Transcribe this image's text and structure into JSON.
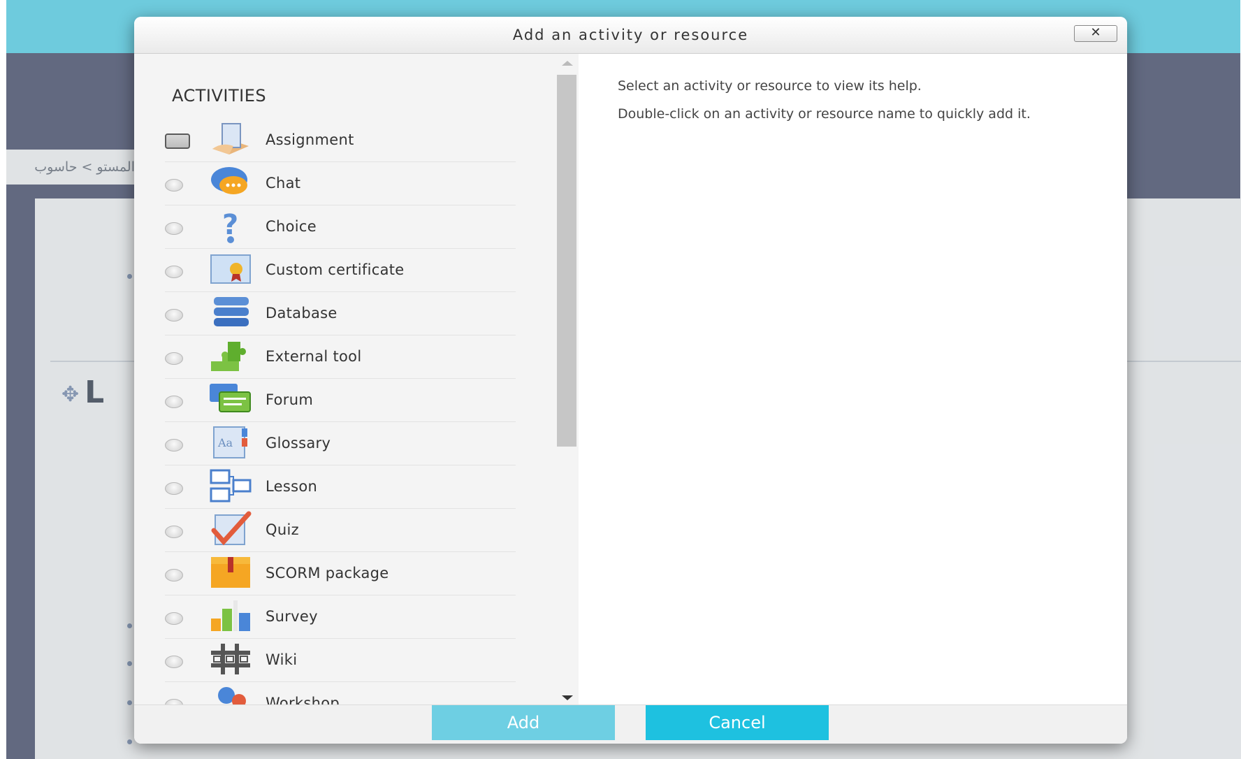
{
  "background": {
    "breadcrumb": "المستو > حاسوب",
    "section_title": "L"
  },
  "modal": {
    "title": "Add an activity or resource",
    "close_label": "✕",
    "section_label": "ACTIVITIES",
    "help": {
      "line1": "Select an activity or resource to view its help.",
      "line2": "Double-click on an activity or resource name to quickly add it."
    },
    "items": [
      {
        "label": "Assignment",
        "icon": "assignment-icon",
        "selected": true
      },
      {
        "label": "Chat",
        "icon": "chat-icon"
      },
      {
        "label": "Choice",
        "icon": "choice-icon"
      },
      {
        "label": "Custom certificate",
        "icon": "certificate-icon"
      },
      {
        "label": "Database",
        "icon": "database-icon"
      },
      {
        "label": "External tool",
        "icon": "external-tool-icon"
      },
      {
        "label": "Forum",
        "icon": "forum-icon"
      },
      {
        "label": "Glossary",
        "icon": "glossary-icon"
      },
      {
        "label": "Lesson",
        "icon": "lesson-icon"
      },
      {
        "label": "Quiz",
        "icon": "quiz-icon"
      },
      {
        "label": "SCORM package",
        "icon": "scorm-icon"
      },
      {
        "label": "Survey",
        "icon": "survey-icon"
      },
      {
        "label": "Wiki",
        "icon": "wiki-icon"
      },
      {
        "label": "Workshop",
        "icon": "workshop-icon"
      }
    ],
    "add_label": "Add",
    "cancel_label": "Cancel"
  },
  "colors": {
    "header_bar": "#4fc0d6",
    "page_dark": "#404864",
    "add_button": "#6ecfe3",
    "cancel_button": "#1ec1e0"
  }
}
